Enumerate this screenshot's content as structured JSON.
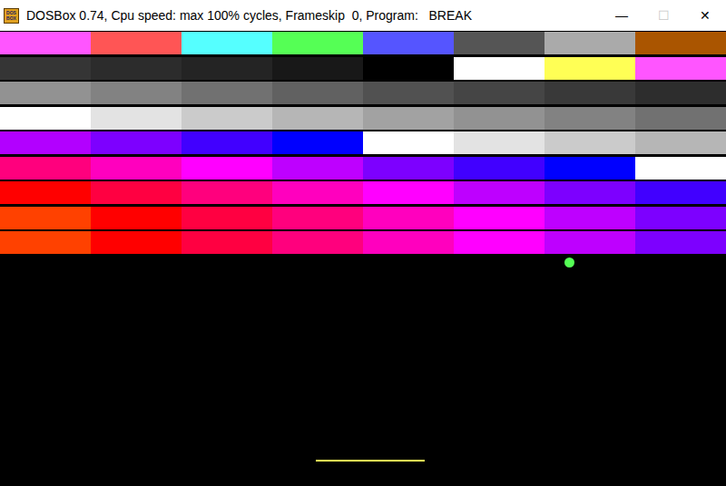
{
  "window": {
    "title": "DOSBox 0.74, Cpu speed: max 100% cycles, Frameskip  0, Program:   BREAK",
    "icon_text": [
      "DOS",
      "BOX"
    ],
    "controls": [
      {
        "glyph": "—",
        "disabled": false
      },
      {
        "glyph": "☐",
        "disabled": true
      },
      {
        "glyph": "✕",
        "disabled": false
      }
    ]
  },
  "bricks": [
    [
      "#ff55ff",
      "#ff5555",
      "#55ffff",
      "#55ff55",
      "#5555ff",
      "#555555",
      "#aaaaaa",
      "#aa5500"
    ],
    [
      "#353535",
      "#2c2c2c",
      "#242424",
      "#181818",
      "#000000",
      "#ffffff",
      "#ffff55",
      "#ff55ff"
    ],
    [
      "#929292",
      "#828282",
      "#717171",
      "#616161",
      "#515151",
      "#454545",
      "#393939",
      "#2d2d2d"
    ],
    [
      "#ffffff",
      "#e3e3e3",
      "#cbcbcb",
      "#b6b6b6",
      "#a2a2a2",
      "#929292",
      "#828282",
      "#717171"
    ],
    [
      "#b200ff",
      "#7d00ff",
      "#4100ff",
      "#0000ff",
      "#ffffff",
      "#e3e3e3",
      "#cbcbcb",
      "#b6b6b6"
    ],
    [
      "#ff007d",
      "#ff00be",
      "#ff00ff",
      "#be00ff",
      "#7d00ff",
      "#4100ff",
      "#0000ff",
      "#ffffff"
    ],
    [
      "#ff0000",
      "#ff0041",
      "#ff007d",
      "#ff00be",
      "#ff00ff",
      "#be00ff",
      "#7d00ff",
      "#4100ff"
    ],
    [
      "#ff4100",
      "#ff0000",
      "#ff0041",
      "#ff007d",
      "#ff00be",
      "#ff00ff",
      "#be00ff",
      "#7d00ff"
    ],
    [
      "#ff4100",
      "#ff0000",
      "#ff0041",
      "#ff007d",
      "#ff00be",
      "#ff00ff",
      "#be00ff",
      "#7d00ff"
    ]
  ],
  "ball": {
    "color": "#55ff55"
  },
  "paddle": {
    "color": "#ffff55"
  }
}
